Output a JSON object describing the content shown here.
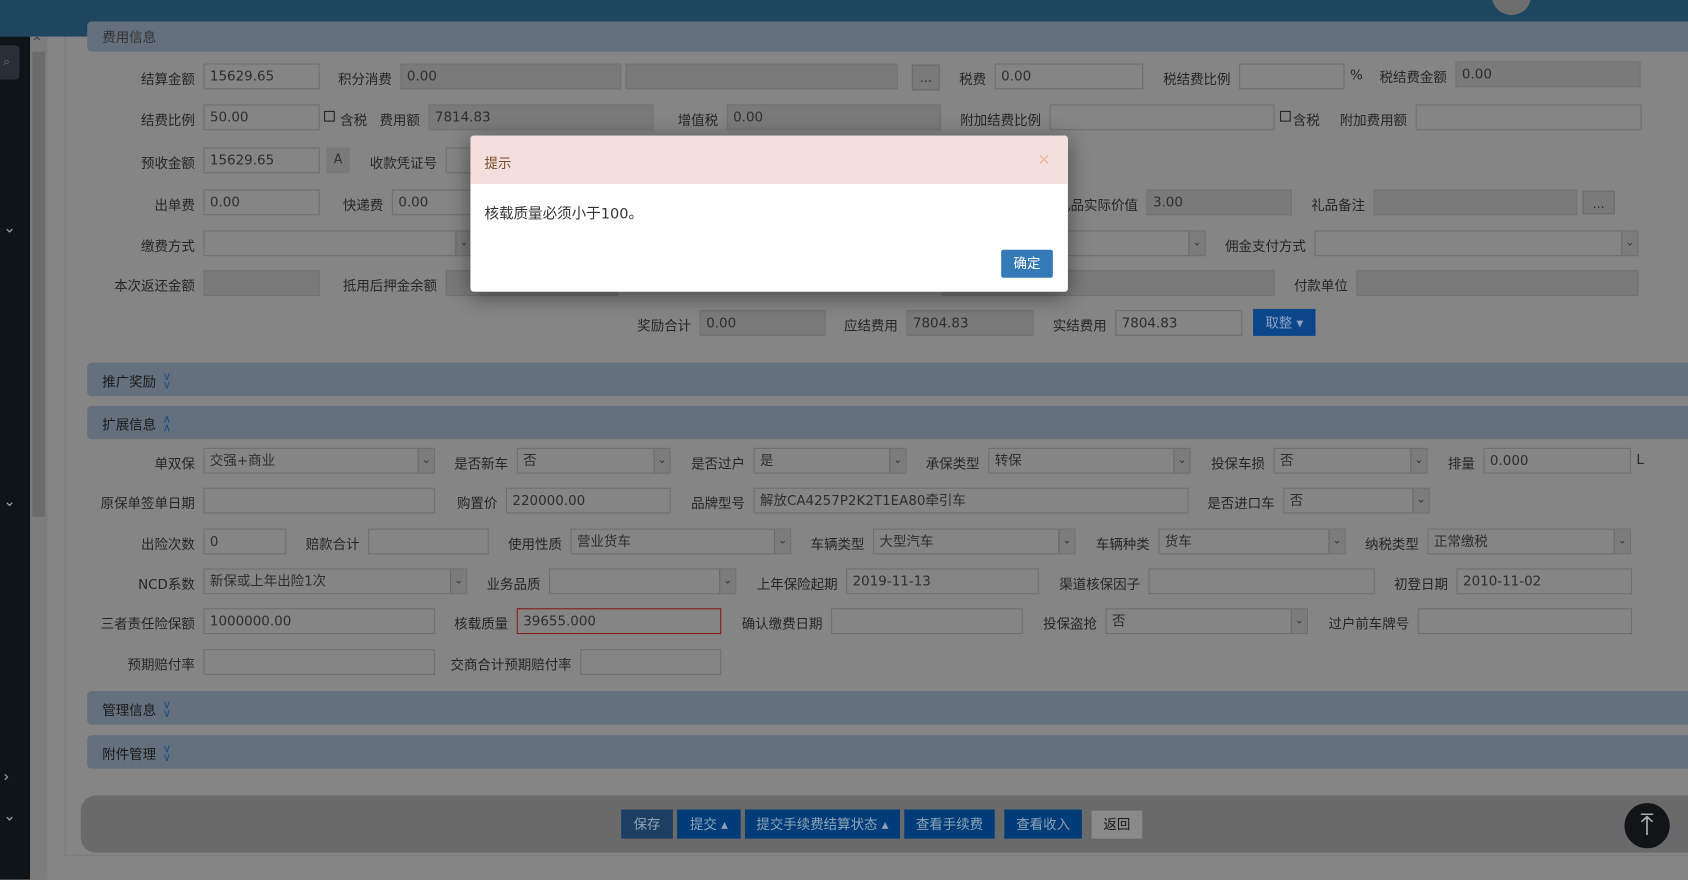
{
  "dialog": {
    "title": "提示",
    "close": "×",
    "message": "核载质量必须小于100。",
    "ok": "确定"
  },
  "fees": {
    "section_title": "费用信息",
    "settle_amount": {
      "label": "结算金额",
      "value": "15629.65"
    },
    "points": {
      "label": "积分消费",
      "value": "0.00"
    },
    "points_extra": {
      "label": "",
      "value": ""
    },
    "tax_fee": {
      "label": "税费",
      "value": "0.00"
    },
    "tax_ratio": {
      "label": "税结费比例",
      "value": ""
    },
    "tax_amount": {
      "label": "税结费金额",
      "value": "0.00"
    },
    "fee_ratio": {
      "label": "结费比例",
      "value": "50.00"
    },
    "fee_amount": {
      "label": "费用额",
      "value": "7814.83"
    },
    "vat": {
      "label": "增值税",
      "value": "0.00"
    },
    "extra_ratio": {
      "label": "附加结费比例",
      "value": ""
    },
    "extra_amount": {
      "label": "附加费用额",
      "value": ""
    },
    "prepaid": {
      "label": "预收金额",
      "value": "15629.65"
    },
    "receipt_no": {
      "label": "收款凭证号",
      "value": ""
    },
    "issue_fee": {
      "label": "出单费",
      "value": "0.00"
    },
    "express": {
      "label": "快递费",
      "value": "0.00"
    },
    "gift_value": {
      "label": "礼品实际价值",
      "value": "3.00"
    },
    "gift_note": {
      "label": "礼品备注",
      "value": ""
    },
    "pay_method": {
      "label": "缴费方式",
      "value": ""
    },
    "hidden_select": {
      "label": "",
      "value": ""
    },
    "commission_pay": {
      "label": "佣金支付方式",
      "value": ""
    },
    "refund": {
      "label": "本次返还金额",
      "value": ""
    },
    "deposit_balance": {
      "label": "抵用后押金余额",
      "value": ""
    },
    "hidden_input": {
      "label": "",
      "value": ""
    },
    "payer": {
      "label": "付款单位",
      "value": ""
    },
    "reward_total": {
      "label": "奖励合计",
      "value": "0.00"
    },
    "payable": {
      "label": "应结费用",
      "value": "7804.83"
    },
    "actual": {
      "label": "实结费用",
      "value": "7804.83"
    },
    "tax_included_label": "含税",
    "percent": "%",
    "ellipsis": "...",
    "a_button": "A",
    "round_button": "取整 ▾"
  },
  "sections": {
    "promo": "推广奖励",
    "ext": "扩展信息",
    "manage": "管理信息",
    "attach": "附件管理"
  },
  "ext": {
    "single_double": {
      "label": "单双保",
      "value": "交强+商业"
    },
    "new_car": {
      "label": "是否新车",
      "value": "否"
    },
    "transfer": {
      "label": "是否过户",
      "value": "是"
    },
    "ins_type": {
      "label": "承保类型",
      "value": "转保"
    },
    "damage": {
      "label": "投保车损",
      "value": "否"
    },
    "displacement": {
      "label": "排量",
      "value": "0.000"
    },
    "orig_sign_date": {
      "label": "原保单签单日期",
      "value": ""
    },
    "price": {
      "label": "购置价",
      "value": "220000.00"
    },
    "brand_model": {
      "label": "品牌型号",
      "value": "解放CA4257P2K2T1EA80牵引车"
    },
    "imported": {
      "label": "是否进口车",
      "value": "否"
    },
    "claims": {
      "label": "出险次数",
      "value": "0"
    },
    "claim_total": {
      "label": "赔款合计",
      "value": ""
    },
    "usage": {
      "label": "使用性质",
      "value": "营业货车"
    },
    "vehicle_type": {
      "label": "车辆类型",
      "value": "大型汽车"
    },
    "vehicle_kind": {
      "label": "车辆种类",
      "value": "货车"
    },
    "tax_type": {
      "label": "纳税类型",
      "value": "正常缴税"
    },
    "ncd": {
      "label": "NCD系数",
      "value": "新保或上年出险1次"
    },
    "biz_quality": {
      "label": "业务品质",
      "value": ""
    },
    "last_start": {
      "label": "上年保险起期",
      "value": "2019-11-13"
    },
    "channel_factor": {
      "label": "渠道核保因子",
      "value": ""
    },
    "first_reg": {
      "label": "初登日期",
      "value": "2010-11-02"
    },
    "third_party": {
      "label": "三者责任险保额",
      "value": "1000000.00"
    },
    "load_mass": {
      "label": "核载质量",
      "value": "39655.000"
    },
    "confirm_date": {
      "label": "确认缴费日期",
      "value": ""
    },
    "theft": {
      "label": "投保盗抢",
      "value": "否"
    },
    "prev_plate": {
      "label": "过户前车牌号",
      "value": ""
    },
    "expected_ratio": {
      "label": "预期赔付率",
      "value": ""
    },
    "combined_ratio": {
      "label": "交商合计预期赔付率",
      "value": ""
    },
    "unit_l": "L"
  },
  "footer": {
    "save": "保存",
    "submit": "提交 ▴",
    "submit_status": "提交手续费结算状态 ▴",
    "view_fee": "查看手续费",
    "view_income": "查看收入",
    "back": "返回"
  }
}
